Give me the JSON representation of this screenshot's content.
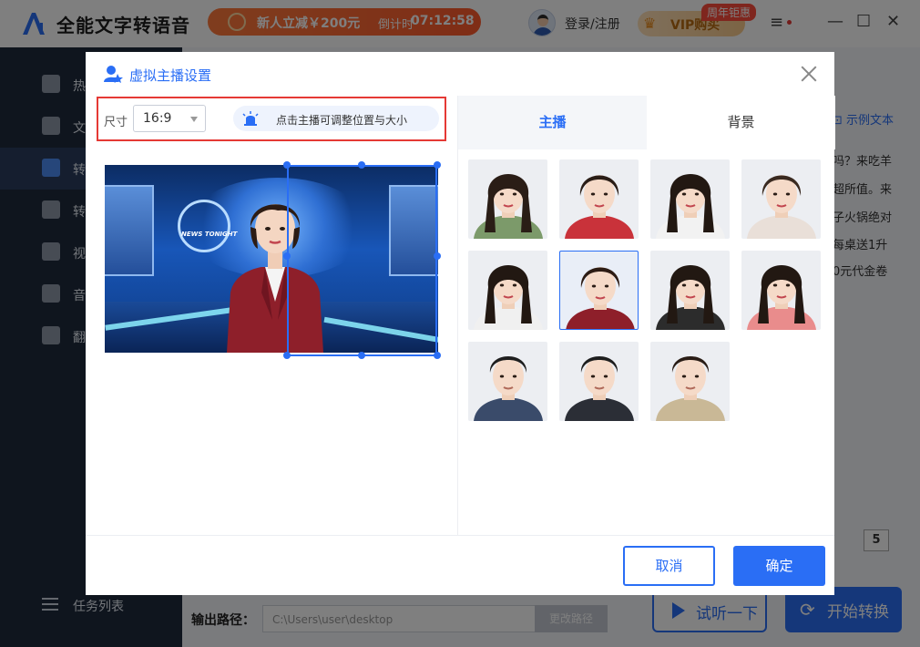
{
  "app": {
    "title": "全能文字转语音",
    "promo_text": "新人立减￥200元",
    "countdown_label": "倒计时",
    "countdown": "07:12:58",
    "login": "登录/注册",
    "vip_label": "VIP购买",
    "vip_tag": "周年钜惠"
  },
  "sidebar": {
    "items": [
      {
        "label": "热"
      },
      {
        "label": "文"
      },
      {
        "label": "转"
      },
      {
        "label": "转"
      },
      {
        "label": "视"
      },
      {
        "label": "音"
      },
      {
        "label": "翻"
      }
    ],
    "task_list": "任务列表"
  },
  "background": {
    "example_link": "示例文本",
    "text_lines": [
      "吗？来吃羊",
      "超所值。来",
      "子火锅绝对",
      "每桌送1升",
      "0元代金卷"
    ],
    "page_number": "5",
    "output_label": "输出路径：",
    "output_path": "C:\\Users\\user\\desktop",
    "change_path": "更改路径",
    "listen_button": "试听一下",
    "start_button": "开始转换"
  },
  "dialog": {
    "title": "虚拟主播设置",
    "size_label": "尺寸",
    "size_value": "16:9",
    "hint": "点击主播可调整位置与大小",
    "preview_news": "NEWS TONIGHT",
    "tabs": [
      {
        "label": "主播",
        "active": true
      },
      {
        "label": "背景",
        "active": false
      }
    ],
    "anchors": [
      {
        "id": "anchor-1",
        "hair": "#2a1d16",
        "top": "#7c9a6a",
        "long_hair": true
      },
      {
        "id": "anchor-2",
        "hair": "#2a1d16",
        "top": "#c9323a",
        "long_hair": false
      },
      {
        "id": "anchor-3",
        "hair": "#221812",
        "top": "#f2f2f2",
        "long_hair": true
      },
      {
        "id": "anchor-4",
        "hair": "#3a2a20",
        "top": "#e9dfd8",
        "long_hair": false
      },
      {
        "id": "anchor-5",
        "hair": "#221812",
        "top": "#f0f0f0",
        "long_hair": true
      },
      {
        "id": "anchor-6",
        "hair": "#2d1c14",
        "top": "#8e1f2a",
        "long_hair": false,
        "selected": true
      },
      {
        "id": "anchor-7",
        "hair": "#221812",
        "top": "#2c2c2c",
        "long_hair": true
      },
      {
        "id": "anchor-8",
        "hair": "#221812",
        "top": "#e98c8c",
        "long_hair": true
      },
      {
        "id": "anchor-9",
        "hair": "#1e1e1e",
        "top": "#3a4b6a",
        "male": true
      },
      {
        "id": "anchor-10",
        "hair": "#1e1e1e",
        "top": "#2b2e36",
        "male": true
      },
      {
        "id": "anchor-11",
        "hair": "#2a1d16",
        "top": "#c9b896",
        "male": true
      }
    ],
    "cancel": "取消",
    "confirm": "确定"
  },
  "colors": {
    "accent": "#2a6ef5",
    "highlight": "#e53935",
    "sidebar": "#1f2a3c"
  }
}
